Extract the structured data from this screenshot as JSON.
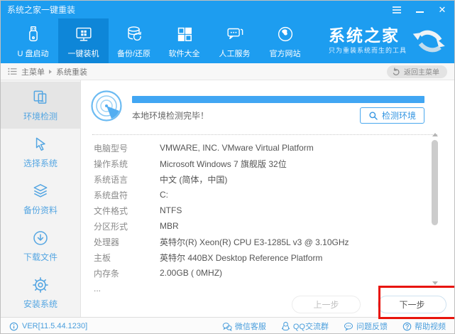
{
  "window": {
    "title": "系统之家一键重装"
  },
  "nav": {
    "items": [
      {
        "label": "U 盘启动",
        "icon": "usb-drive-icon",
        "active": false
      },
      {
        "label": "一键装机",
        "icon": "monitor-windows-icon",
        "active": true
      },
      {
        "label": "备份/还原",
        "icon": "database-restore-icon",
        "active": false
      },
      {
        "label": "软件大全",
        "icon": "apps-grid-icon",
        "active": false
      },
      {
        "label": "人工服务",
        "icon": "chat-service-icon",
        "active": false
      },
      {
        "label": "官方网站",
        "icon": "globe-icon",
        "active": false
      }
    ],
    "brand": {
      "name": "系统之家",
      "tagline": "只为重装系统而生的工具",
      "logo_icon": "double-arrow-swoosh-icon"
    }
  },
  "breadcrumb": {
    "root": "主菜单",
    "current": "系统重装",
    "back_button": "返回主菜单"
  },
  "sidebar": {
    "items": [
      {
        "label": "环境检测",
        "icon": "env-detect-icon",
        "active": true
      },
      {
        "label": "选择系统",
        "icon": "select-cursor-icon",
        "active": false
      },
      {
        "label": "备份资料",
        "icon": "backup-layers-icon",
        "active": false
      },
      {
        "label": "下载文件",
        "icon": "download-circle-icon",
        "active": false
      },
      {
        "label": "安装系统",
        "icon": "gear-icon",
        "active": false
      }
    ]
  },
  "main": {
    "progress_percent": 100,
    "status_text": "本地环境检测完毕！",
    "detect_button": "检测环境",
    "details": [
      {
        "label": "电脑型号",
        "value": "VMWARE, INC. VMware Virtual Platform"
      },
      {
        "label": "操作系统",
        "value": "Microsoft Windows 7 旗舰版  32位"
      },
      {
        "label": "系统语言",
        "value": "中文 (简体，中国)"
      },
      {
        "label": "系统盘符",
        "value": "C:"
      },
      {
        "label": "文件格式",
        "value": "NTFS"
      },
      {
        "label": "分区形式",
        "value": "MBR"
      },
      {
        "label": "处理器",
        "value": "英特尔(R) Xeon(R) CPU E3-1285L v3 @ 3.10GHz"
      },
      {
        "label": "主板",
        "value": "英特尔 440BX Desktop Reference Platform"
      },
      {
        "label": "内存条",
        "value": "2.00GB ( 0MHZ)"
      },
      {
        "label": "...",
        "value": ""
      }
    ],
    "prev_button": "上一步",
    "next_button": "下一步"
  },
  "statusbar": {
    "version": "VER[11.5.44.1230]",
    "links": [
      {
        "label": "微信客服",
        "icon": "wechat-icon"
      },
      {
        "label": "QQ交流群",
        "icon": "qq-icon"
      },
      {
        "label": "问题反馈",
        "icon": "feedback-bubble-icon"
      },
      {
        "label": "帮助视频",
        "icon": "help-circle-icon"
      }
    ]
  },
  "colors": {
    "primary_blue": "#1d9df0",
    "active_nav_blue": "#0e86d8",
    "sidebar_accent_blue": "#55a6e2",
    "progress_blue": "#41a6f3",
    "annotation_red": "#e8140c"
  }
}
